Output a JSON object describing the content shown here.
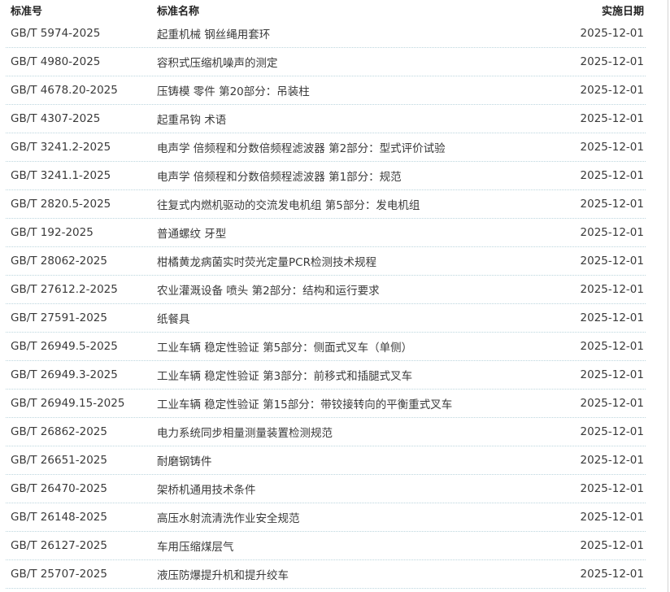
{
  "table": {
    "headers": {
      "number": "标准号",
      "name": "标准名称",
      "date": "实施日期"
    },
    "rows": [
      {
        "number": "GB/T 5974-2025",
        "name": "起重机械 钢丝绳用套环",
        "date": "2025-12-01"
      },
      {
        "number": "GB/T 4980-2025",
        "name": "容积式压缩机噪声的测定",
        "date": "2025-12-01"
      },
      {
        "number": "GB/T 4678.20-2025",
        "name": "压铸模 零件 第20部分：吊装柱",
        "date": "2025-12-01"
      },
      {
        "number": "GB/T 4307-2025",
        "name": "起重吊钩 术语",
        "date": "2025-12-01"
      },
      {
        "number": "GB/T 3241.2-2025",
        "name": "电声学 倍频程和分数倍频程滤波器 第2部分：型式评价试验",
        "date": "2025-12-01"
      },
      {
        "number": "GB/T 3241.1-2025",
        "name": "电声学 倍频程和分数倍频程滤波器 第1部分：规范",
        "date": "2025-12-01"
      },
      {
        "number": "GB/T 2820.5-2025",
        "name": "往复式内燃机驱动的交流发电机组 第5部分：发电机组",
        "date": "2025-12-01"
      },
      {
        "number": "GB/T 192-2025",
        "name": "普通螺纹 牙型",
        "date": "2025-12-01"
      },
      {
        "number": "GB/T 28062-2025",
        "name": "柑橘黄龙病菌实时荧光定量PCR检测技术规程",
        "date": "2025-12-01"
      },
      {
        "number": "GB/T 27612.2-2025",
        "name": "农业灌溉设备 喷头 第2部分：结构和运行要求",
        "date": "2025-12-01"
      },
      {
        "number": "GB/T 27591-2025",
        "name": "纸餐具",
        "date": "2025-12-01"
      },
      {
        "number": "GB/T 26949.5-2025",
        "name": "工业车辆 稳定性验证 第5部分：侧面式叉车（单侧）",
        "date": "2025-12-01"
      },
      {
        "number": "GB/T 26949.3-2025",
        "name": "工业车辆 稳定性验证 第3部分：前移式和插腿式叉车",
        "date": "2025-12-01"
      },
      {
        "number": "GB/T 26949.15-2025",
        "name": "工业车辆 稳定性验证 第15部分：带铰接转向的平衡重式叉车",
        "date": "2025-12-01"
      },
      {
        "number": "GB/T 26862-2025",
        "name": "电力系统同步相量测量装置检测规范",
        "date": "2025-12-01"
      },
      {
        "number": "GB/T 26651-2025",
        "name": "耐磨钢铸件",
        "date": "2025-12-01"
      },
      {
        "number": "GB/T 26470-2025",
        "name": "架桥机通用技术条件",
        "date": "2025-12-01"
      },
      {
        "number": "GB/T 26148-2025",
        "name": "高压水射流清洗作业安全规范",
        "date": "2025-12-01"
      },
      {
        "number": "GB/T 26127-2025",
        "name": "车用压缩煤层气",
        "date": "2025-12-01"
      },
      {
        "number": "GB/T 25707-2025",
        "name": "液压防爆提升机和提升绞车",
        "date": "2025-12-01"
      }
    ]
  }
}
